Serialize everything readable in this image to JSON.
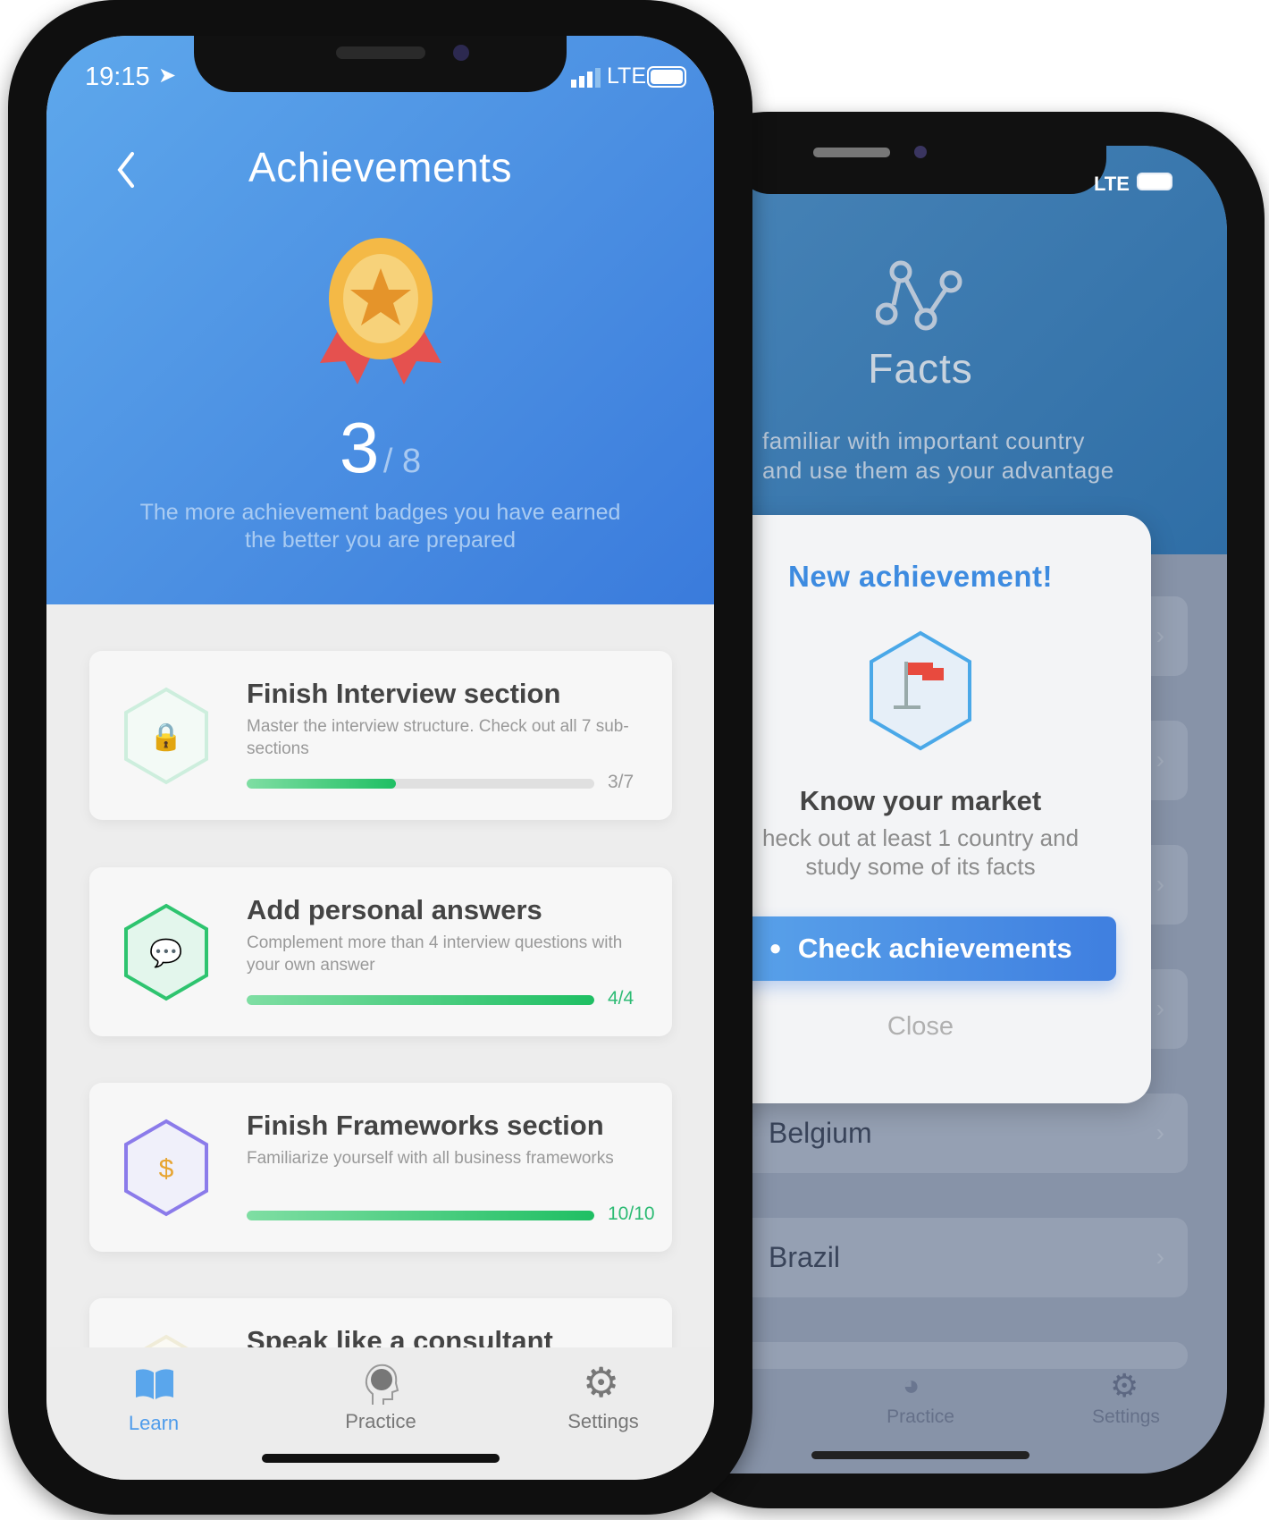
{
  "colors": {
    "accent": "#3d8be0",
    "progress": "#1fbf63",
    "header_blue": "#4b8fe2"
  },
  "front_phone": {
    "status": {
      "time": "19:15",
      "network": "LTE",
      "icons": [
        "location-arrow-icon",
        "signal-icon",
        "battery-icon"
      ]
    },
    "header": {
      "back_icon": "chevron-left-icon",
      "title": "Achievements",
      "earned": "3",
      "total": "/ 8",
      "subtitle_line1": "The more achievement badges you have earned",
      "subtitle_line2": "the better you are prepared"
    },
    "achievements": [
      {
        "title": "Finish Interview section",
        "desc": "Master the interview structure. Check out all 7 sub-sections",
        "progress": 0.4286,
        "count": "3/7",
        "count_color": "#9a9a9a",
        "icon": "lock-icon",
        "hex_color": "#cdeedd",
        "hex_fill": "#f3faf6"
      },
      {
        "title": "Add personal answers",
        "desc": "Complement more than 4 interview questions with your own answer",
        "progress": 1,
        "count": "4/4",
        "count_color": "#2dbb74",
        "icon": "chat-bubbles-icon",
        "hex_color": "#2ec46f",
        "hex_fill": "#e3f6ec"
      },
      {
        "title": "Finish Frameworks section",
        "desc": "Familiarize yourself with all business frameworks",
        "progress": 1,
        "count": "10/10",
        "count_color": "#2dbb74",
        "icon": "lightbulb-dollar-icon",
        "hex_color": "#8b7bea",
        "hex_fill": "#f0f0fa"
      },
      {
        "title": "Speak like a consultant",
        "icon": "locked-badge-icon",
        "hex_color": "#f0ecd8",
        "hex_fill": "#fbfaf4"
      }
    ],
    "tabs": [
      {
        "label": "Learn",
        "icon": "book-icon",
        "active": true
      },
      {
        "label": "Practice",
        "icon": "head-brain-icon"
      },
      {
        "label": "Settings",
        "icon": "gear-icon"
      }
    ]
  },
  "back_phone": {
    "status": {
      "network": "LTE"
    },
    "header": {
      "icon": "graph-nodes-icon",
      "title": "Facts",
      "desc_line1": "familiar with important country",
      "desc_line2": "and use them as your advantage"
    },
    "modal": {
      "title": "New achievement!",
      "icon": "flag-hexagon-icon",
      "name": "Know your market",
      "desc_line1": "heck out at least 1 country and",
      "desc_line2": "study some of its facts",
      "button": "Check achievements",
      "close": "Close"
    },
    "countries": [
      "Belgium",
      "Brazil"
    ],
    "tabs": [
      {
        "label": "Practice",
        "icon": "head-brain-icon"
      },
      {
        "label": "Settings",
        "icon": "gear-icon"
      }
    ]
  }
}
